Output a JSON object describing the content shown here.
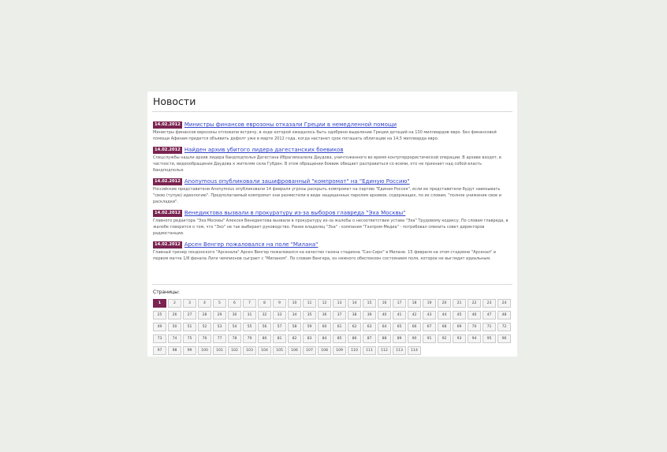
{
  "section": {
    "title": "Новости",
    "pages_label": "Страницы:"
  },
  "news": [
    {
      "date": "14.02.2012",
      "title": "Министры финансов еврозоны отказали Греции в немедленной помощи",
      "text": "Министры финансов еврозоны отложили встречу, в ходе которой ожидалось быть одобрено выделение Греции дотаций на 130 миллиардов евро. Без финансовой помощи Афинам придется объявить дефолт уже в марте 2012 года, когда настанет срок погашать облигации на 14,5 миллиарда евро."
    },
    {
      "date": "14.02.2012",
      "title": "Найден архив убитого лидера дагестанских боевиков",
      "text": "Спецслужбы нашли архив лидера бандподполья Дагестана Ибрагимхалила Даудова, уничтоженного во время контртеррористической операции. В архиве входят, в частности, видеообращения Даудова к жителям села Губден. В этом обращении боевик обещает расправиться со всеми, кто не признает над собой власть бандподполья."
    },
    {
      "date": "14.02.2012",
      "title": "Anonymous опубликовали зашифрованный \"компромат\" на \"Единую Россию\"",
      "text": "Российские представители Anonymous опубликовали 14 февраля угрозы раскрыть компромат на партию \"Единая Россия\", если ее представители будут навязывать \"свою (тупую) идеологию\". Предполагаемый компромат они разместили в виде защищенных паролем архивов, содержащих, по их словам, \"полное унижение свое и раскладки\"."
    },
    {
      "date": "14.02.2012",
      "title": "Венедиктова вызвали в прокуратуру из-за выборов главреда \"Эха Москвы\"",
      "text": "Главного редактора \"Эха Москвы\" Алексея Венедиктова вызвали в прокуратуру из-за жалобы о несоответствии устава \"Эха\" Трудовому кодексу. По словам главреда, в жалобе говорится о том, что \"Эхо\" не так выбирает руководство. Ранее владелец \"Эха\" - компания \"Газпром-Медиа\" - потребовал сменить совет директоров радиостанции."
    },
    {
      "date": "14.02.2012",
      "title": "Арсен Венгер пожаловался на поле \"Милана\"",
      "text": "Главный тренер лондонского \"Арсенала\" Арсен Венгер пожаловался на качество газона стадиона \"Сан-Сиро\" в Милане. 15 февраля на этом стадионе \"Арсенал\" в первом матче 1/8 финала Лиги чемпионов сыграет с \"Миланом\". По словам Венгера, он немного обеспокоен состоянием поля, которое не выглядит идеальным."
    }
  ],
  "pagination": {
    "current": "1",
    "pages": [
      "1",
      "2",
      "3",
      "4",
      "5",
      "6",
      "7",
      "8",
      "9",
      "10",
      "11",
      "12",
      "13",
      "14",
      "15",
      "16",
      "17",
      "18",
      "19",
      "20",
      "21",
      "22",
      "23",
      "24",
      "25",
      "26",
      "27",
      "28",
      "29",
      "30",
      "31",
      "32",
      "33",
      "34",
      "35",
      "36",
      "37",
      "38",
      "39",
      "40",
      "41",
      "42",
      "43",
      "44",
      "45",
      "46",
      "47",
      "48",
      "49",
      "50",
      "51",
      "52",
      "53",
      "54",
      "55",
      "56",
      "57",
      "58",
      "59",
      "60",
      "61",
      "62",
      "63",
      "64",
      "65",
      "66",
      "67",
      "68",
      "69",
      "70",
      "71",
      "72",
      "73",
      "74",
      "75",
      "76",
      "77",
      "78",
      "79",
      "80",
      "81",
      "82",
      "83",
      "84",
      "85",
      "86",
      "87",
      "88",
      "89",
      "90",
      "91",
      "92",
      "93",
      "94",
      "95",
      "96",
      "97",
      "98",
      "99",
      "100",
      "101",
      "102",
      "103",
      "104",
      "105",
      "106",
      "107",
      "108",
      "109",
      "110",
      "111",
      "112",
      "113",
      "114"
    ]
  }
}
